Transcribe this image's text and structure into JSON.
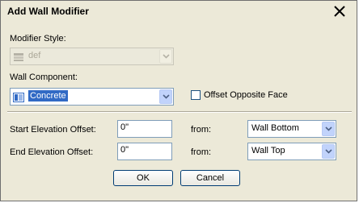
{
  "window": {
    "title": "Add Wall Modifier",
    "close_icon": "close-icon"
  },
  "modifier_style": {
    "label": "Modifier Style:",
    "value": "def",
    "disabled": true
  },
  "wall_component": {
    "label": "Wall Component:",
    "value": "Concrete"
  },
  "offset_opposite_face": {
    "label": "Offset Opposite Face",
    "checked": false
  },
  "start_elevation": {
    "label": "Start Elevation Offset:",
    "value": "0\"",
    "from_label": "from:",
    "from_value": "Wall Bottom"
  },
  "end_elevation": {
    "label": "End Elevation Offset:",
    "value": "0\"",
    "from_label": "from:",
    "from_value": "Wall Top"
  },
  "buttons": {
    "ok": "OK",
    "cancel": "Cancel"
  },
  "colors": {
    "selection": "#316ac5",
    "dialog_bg": "#ece9d8",
    "border": "#7f9db9"
  }
}
